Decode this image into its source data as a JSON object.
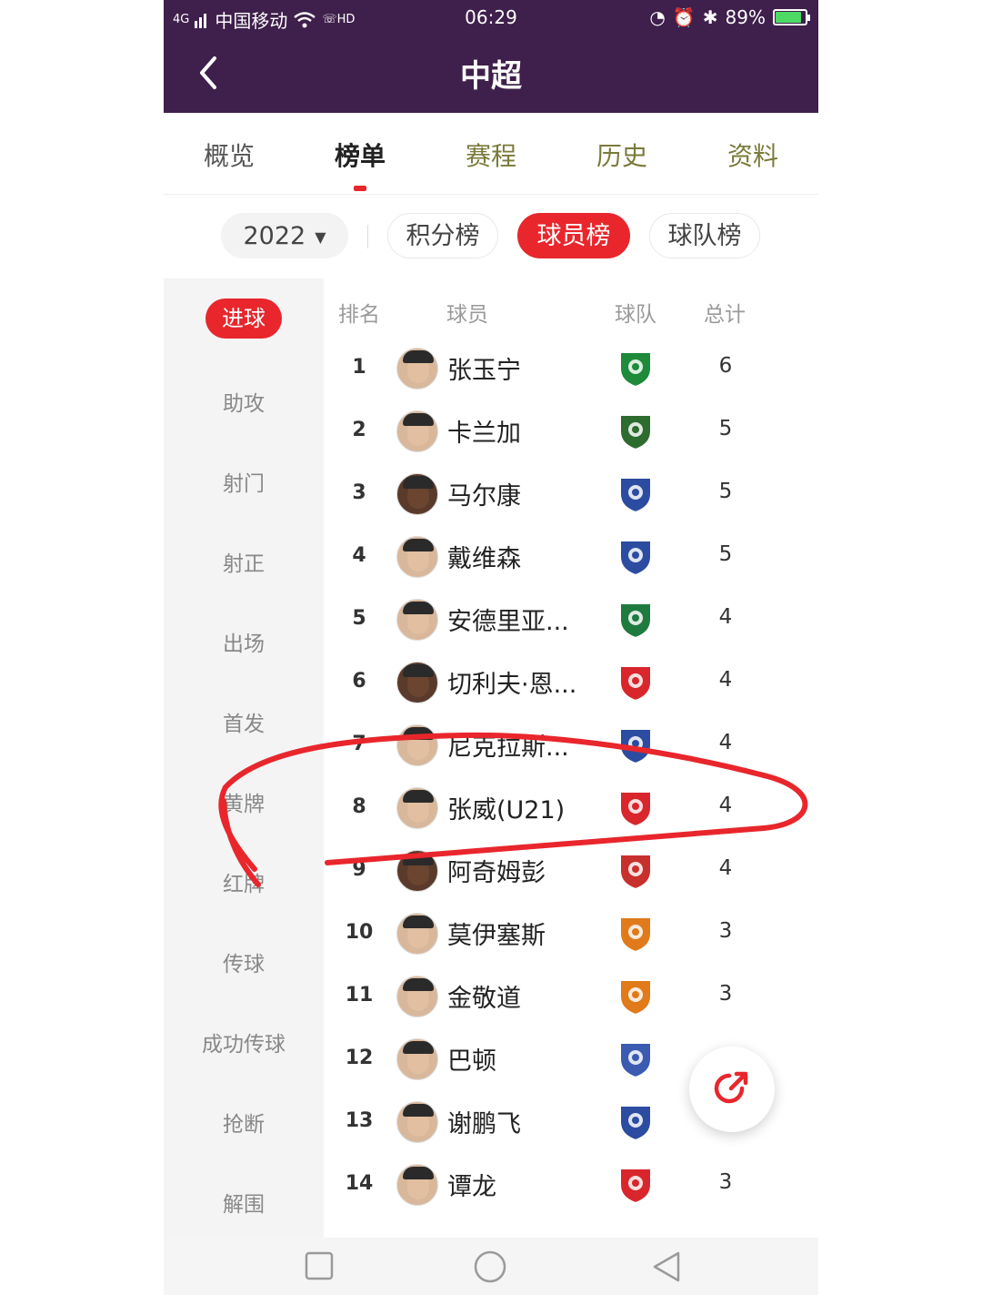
{
  "status_bar": {
    "carrier": "中国移动",
    "signal": "4G",
    "hd": "HD",
    "time": "06:29",
    "battery": "89%",
    "battery_fraction": 0.89
  },
  "header": {
    "title": "中超"
  },
  "tabs": [
    {
      "label": "概览"
    },
    {
      "label": "榜单"
    },
    {
      "label": "赛程"
    },
    {
      "label": "历史"
    },
    {
      "label": "资料"
    }
  ],
  "filters": {
    "season": "2022",
    "points_table": "积分榜",
    "player_table": "球员榜",
    "team_table": "球队榜"
  },
  "sidebar": [
    {
      "label": "进球"
    },
    {
      "label": "助攻"
    },
    {
      "label": "射门"
    },
    {
      "label": "射正"
    },
    {
      "label": "出场"
    },
    {
      "label": "首发"
    },
    {
      "label": "黄牌"
    },
    {
      "label": "红牌"
    },
    {
      "label": "传球"
    },
    {
      "label": "成功传球"
    },
    {
      "label": "抢断"
    },
    {
      "label": "解围"
    }
  ],
  "table": {
    "headers": {
      "rank": "排名",
      "player": "球员",
      "team": "球队",
      "total": "总计"
    },
    "rows": [
      {
        "rank": "1",
        "player": "张玉宁",
        "total": "6",
        "team_color": "#1e8a3a"
      },
      {
        "rank": "2",
        "player": "卡兰加",
        "total": "5",
        "team_color": "#2d6b2f"
      },
      {
        "rank": "3",
        "player": "马尔康",
        "total": "5",
        "team_color": "#2b4ca0"
      },
      {
        "rank": "4",
        "player": "戴维森",
        "total": "5",
        "team_color": "#2b4ca0"
      },
      {
        "rank": "5",
        "player": "安德里亚...",
        "total": "4",
        "team_color": "#1f7a3f"
      },
      {
        "rank": "6",
        "player": "切利夫·恩...",
        "total": "4",
        "team_color": "#d8262c"
      },
      {
        "rank": "7",
        "player": "尼克拉斯...",
        "total": "4",
        "team_color": "#2b4ca0"
      },
      {
        "rank": "8",
        "player": "张威(U21)",
        "total": "4",
        "team_color": "#d8262c"
      },
      {
        "rank": "9",
        "player": "阿奇姆彭",
        "total": "4",
        "team_color": "#c8302e"
      },
      {
        "rank": "10",
        "player": "莫伊塞斯",
        "total": "3",
        "team_color": "#e07a1a"
      },
      {
        "rank": "11",
        "player": "金敬道",
        "total": "3",
        "team_color": "#e07a1a"
      },
      {
        "rank": "12",
        "player": "巴顿",
        "total": "",
        "team_color": "#3a5bb0"
      },
      {
        "rank": "13",
        "player": "谢鹏飞",
        "total": "",
        "team_color": "#2b4ca0"
      },
      {
        "rank": "14",
        "player": "谭龙",
        "total": "3",
        "team_color": "#d8262c"
      }
    ]
  }
}
